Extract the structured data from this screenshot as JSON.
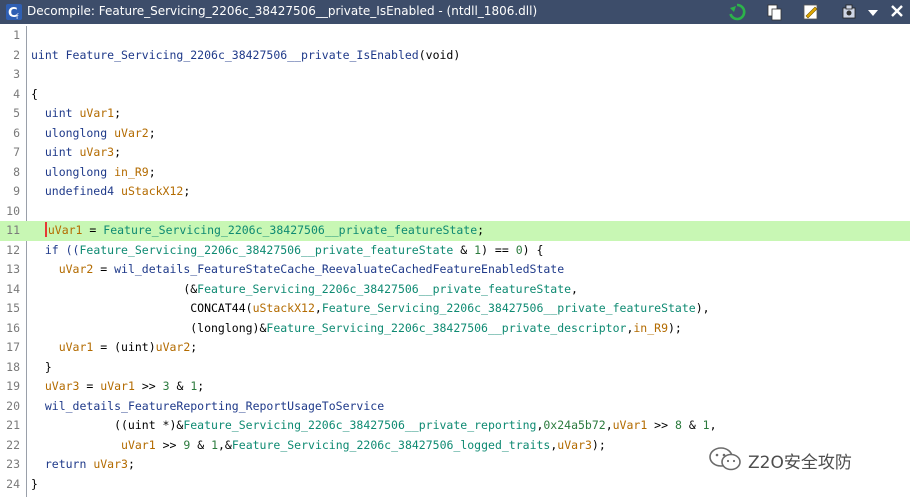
{
  "window": {
    "title": "Decompile: Feature_Servicing_2206c_38427506__private_IsEnabled -  (ntdll_1806.dll)",
    "icon_names": [
      "ghidra-logo-icon",
      "refresh-icon",
      "copy-icon",
      "edit-icon",
      "snapshot-icon",
      "dropdown-icon",
      "close-icon"
    ]
  },
  "code": {
    "highlight_line": 11,
    "lines": [
      {
        "n": "1",
        "parts": []
      },
      {
        "n": "2",
        "parts": [
          {
            "t": "uint ",
            "c": "tok-t"
          },
          {
            "t": "Feature_Servicing_2206c_38427506__private_IsEnabled",
            "c": "tok-fn"
          },
          {
            "t": "(void)",
            "c": ""
          }
        ]
      },
      {
        "n": "3",
        "parts": []
      },
      {
        "n": "4",
        "parts": [
          {
            "t": "{",
            "c": ""
          }
        ]
      },
      {
        "n": "5",
        "parts": [
          {
            "t": "  uint ",
            "c": "tok-t"
          },
          {
            "t": "uVar1",
            "c": "tok-var"
          },
          {
            "t": ";",
            "c": ""
          }
        ]
      },
      {
        "n": "6",
        "parts": [
          {
            "t": "  ulonglong ",
            "c": "tok-t"
          },
          {
            "t": "uVar2",
            "c": "tok-var"
          },
          {
            "t": ";",
            "c": ""
          }
        ]
      },
      {
        "n": "7",
        "parts": [
          {
            "t": "  uint ",
            "c": "tok-t"
          },
          {
            "t": "uVar3",
            "c": "tok-var"
          },
          {
            "t": ";",
            "c": ""
          }
        ]
      },
      {
        "n": "8",
        "parts": [
          {
            "t": "  ulonglong ",
            "c": "tok-t"
          },
          {
            "t": "in_R9",
            "c": "tok-var"
          },
          {
            "t": ";",
            "c": ""
          }
        ]
      },
      {
        "n": "9",
        "parts": [
          {
            "t": "  undefined4 ",
            "c": "tok-t"
          },
          {
            "t": "uStackX12",
            "c": "tok-var"
          },
          {
            "t": ";",
            "c": ""
          }
        ]
      },
      {
        "n": "10",
        "parts": []
      },
      {
        "n": "11",
        "parts": [
          {
            "t": "  ",
            "c": ""
          },
          {
            "t": "uVar1",
            "c": "tok-var",
            "cursor": true
          },
          {
            "t": " = ",
            "c": ""
          },
          {
            "t": "Feature_Servicing_2206c_38427506__private_featureState",
            "c": "tok-g"
          },
          {
            "t": ";",
            "c": ""
          }
        ]
      },
      {
        "n": "12",
        "parts": [
          {
            "t": "  if ((",
            "c": "tok-t"
          },
          {
            "t": "Feature_Servicing_2206c_38427506__private_featureState",
            "c": "tok-g"
          },
          {
            "t": " & ",
            "c": ""
          },
          {
            "t": "1",
            "c": "tok-n"
          },
          {
            "t": ") == ",
            "c": ""
          },
          {
            "t": "0",
            "c": "tok-n"
          },
          {
            "t": ") {",
            "c": ""
          }
        ]
      },
      {
        "n": "13",
        "parts": [
          {
            "t": "    ",
            "c": ""
          },
          {
            "t": "uVar2",
            "c": "tok-var"
          },
          {
            "t": " = ",
            "c": ""
          },
          {
            "t": "wil_details_FeatureStateCache_ReevaluateCachedFeatureEnabledState",
            "c": "tok-fn"
          }
        ]
      },
      {
        "n": "14",
        "parts": [
          {
            "t": "                      (&",
            "c": ""
          },
          {
            "t": "Feature_Servicing_2206c_38427506__private_featureState",
            "c": "tok-g"
          },
          {
            "t": ",",
            "c": ""
          }
        ]
      },
      {
        "n": "15",
        "parts": [
          {
            "t": "                       CONCAT44(",
            "c": ""
          },
          {
            "t": "uStackX12",
            "c": "tok-var"
          },
          {
            "t": ",",
            "c": ""
          },
          {
            "t": "Feature_Servicing_2206c_38427506__private_featureState",
            "c": "tok-g"
          },
          {
            "t": "),",
            "c": ""
          }
        ]
      },
      {
        "n": "16",
        "parts": [
          {
            "t": "                       (longlong)&",
            "c": ""
          },
          {
            "t": "Feature_Servicing_2206c_38427506__private_descriptor",
            "c": "tok-g"
          },
          {
            "t": ",",
            "c": ""
          },
          {
            "t": "in_R9",
            "c": "tok-var"
          },
          {
            "t": ");",
            "c": ""
          }
        ]
      },
      {
        "n": "17",
        "parts": [
          {
            "t": "    ",
            "c": ""
          },
          {
            "t": "uVar1",
            "c": "tok-var"
          },
          {
            "t": " = (uint)",
            "c": ""
          },
          {
            "t": "uVar2",
            "c": "tok-var"
          },
          {
            "t": ";",
            "c": ""
          }
        ]
      },
      {
        "n": "18",
        "parts": [
          {
            "t": "  }",
            "c": ""
          }
        ]
      },
      {
        "n": "19",
        "parts": [
          {
            "t": "  ",
            "c": ""
          },
          {
            "t": "uVar3",
            "c": "tok-var"
          },
          {
            "t": " = ",
            "c": ""
          },
          {
            "t": "uVar1",
            "c": "tok-var"
          },
          {
            "t": " >> ",
            "c": ""
          },
          {
            "t": "3",
            "c": "tok-n"
          },
          {
            "t": " & ",
            "c": ""
          },
          {
            "t": "1",
            "c": "tok-n"
          },
          {
            "t": ";",
            "c": ""
          }
        ]
      },
      {
        "n": "20",
        "parts": [
          {
            "t": "  ",
            "c": ""
          },
          {
            "t": "wil_details_FeatureReporting_ReportUsageToService",
            "c": "tok-fn"
          }
        ]
      },
      {
        "n": "21",
        "parts": [
          {
            "t": "            ((uint *)&",
            "c": ""
          },
          {
            "t": "Feature_Servicing_2206c_38427506__private_reporting",
            "c": "tok-g"
          },
          {
            "t": ",",
            "c": ""
          },
          {
            "t": "0x24a5b72",
            "c": "tok-n"
          },
          {
            "t": ",",
            "c": ""
          },
          {
            "t": "uVar1",
            "c": "tok-var"
          },
          {
            "t": " >> ",
            "c": ""
          },
          {
            "t": "8",
            "c": "tok-n"
          },
          {
            "t": " & ",
            "c": ""
          },
          {
            "t": "1",
            "c": "tok-n"
          },
          {
            "t": ",",
            "c": ""
          }
        ]
      },
      {
        "n": "22",
        "parts": [
          {
            "t": "             ",
            "c": ""
          },
          {
            "t": "uVar1",
            "c": "tok-var"
          },
          {
            "t": " >> ",
            "c": ""
          },
          {
            "t": "9",
            "c": "tok-n"
          },
          {
            "t": " & ",
            "c": ""
          },
          {
            "t": "1",
            "c": "tok-n"
          },
          {
            "t": ",&",
            "c": ""
          },
          {
            "t": "Feature_Servicing_2206c_38427506_logged_traits",
            "c": "tok-g"
          },
          {
            "t": ",",
            "c": ""
          },
          {
            "t": "uVar3",
            "c": "tok-var"
          },
          {
            "t": ");",
            "c": ""
          }
        ]
      },
      {
        "n": "23",
        "parts": [
          {
            "t": "  return ",
            "c": "tok-t"
          },
          {
            "t": "uVar3",
            "c": "tok-var"
          },
          {
            "t": ";",
            "c": ""
          }
        ]
      },
      {
        "n": "24",
        "parts": [
          {
            "t": "}",
            "c": ""
          }
        ]
      }
    ]
  },
  "watermark": {
    "text": "Z2O安全攻防",
    "icon": "wechat-icon"
  }
}
